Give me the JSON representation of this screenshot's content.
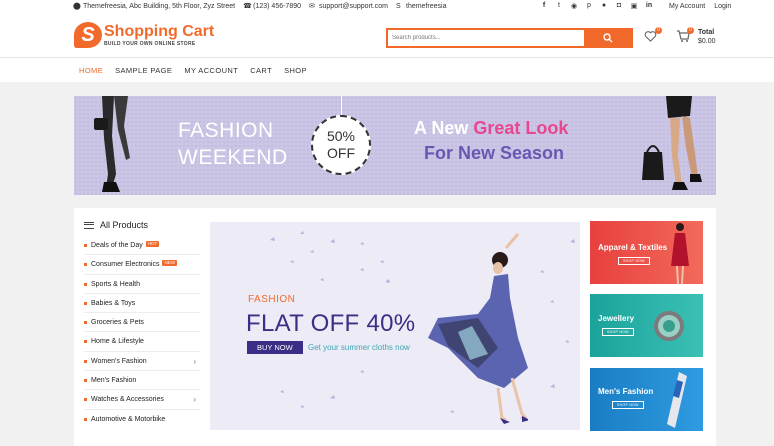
{
  "topbar": {
    "address": "Themefreesia, Abc Building, 5th Floor, Zyz Street",
    "phone": "(123) 456-7890",
    "email": "support@support.com",
    "skype": "themefreesia",
    "my_account": "My Account",
    "login": "Login"
  },
  "header": {
    "logo_letter": "S",
    "logo_title": "Shopping Cart",
    "logo_tagline": "BUILD YOUR OWN ONLINE STORE",
    "search_placeholder": "Search products...",
    "wishlist_count": "0",
    "cart_count": "0",
    "total_label": "Total",
    "total_value": "$0.00"
  },
  "nav": {
    "items": [
      "HOME",
      "SAMPLE PAGE",
      "MY ACCOUNT",
      "CART",
      "SHOP"
    ]
  },
  "hero": {
    "left_line1": "FASHION",
    "left_line2": "WEEKEND",
    "badge_line1": "50%",
    "badge_line2": "OFF",
    "right_line1_a": "A New",
    "right_line1_b": "Great Look",
    "right_line2": "For New Season"
  },
  "categories": {
    "heading": "All Products",
    "items": [
      {
        "label": "Deals of the Day",
        "tag": "HOT",
        "tag_color": "#f26a2b"
      },
      {
        "label": "Consumer Electronics",
        "tag": "NEW",
        "tag_color": "#f26a2b"
      },
      {
        "label": "Sports & Health"
      },
      {
        "label": "Babies & Toys"
      },
      {
        "label": "Groceries & Pets"
      },
      {
        "label": "Home & Lifestyle"
      },
      {
        "label": "Women's Fashion",
        "has_sub": true
      },
      {
        "label": "Men's Fashion"
      },
      {
        "label": "Watches & Accessories",
        "has_sub": true
      },
      {
        "label": "Automotive & Motorbike"
      }
    ]
  },
  "slider": {
    "kicker": "FASHION",
    "headline": "FLAT OFF 40%",
    "button": "BUY NOW",
    "subtext": "Get your summer cloths now"
  },
  "promos": [
    {
      "title": "Apparel & Textiles",
      "button": "SHOP NOW"
    },
    {
      "title": "Jewellery",
      "button": "SHOP NOW"
    },
    {
      "title": "Men's Fashion",
      "button": "SHOP NOW"
    }
  ],
  "colors": {
    "accent": "#f26a2b",
    "hero_bg": "#cbc6e6",
    "headline_purple": "#3a2e86",
    "hot_pink": "#e8478f"
  }
}
